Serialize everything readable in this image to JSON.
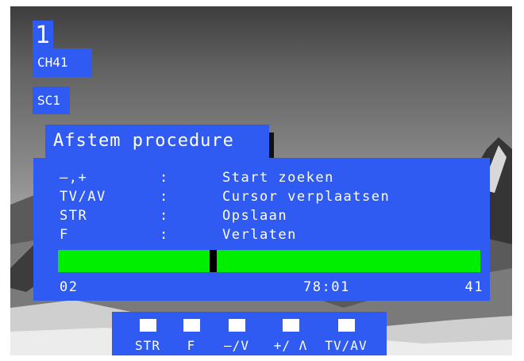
{
  "osd": {
    "program_number": "1",
    "channel": "CH41",
    "source": "SC1"
  },
  "dialog": {
    "title": "Afstem procedure",
    "commands": [
      {
        "key": "–,+",
        "separator": ":",
        "action": "Start zoeken"
      },
      {
        "key": "TV/AV",
        "separator": ":",
        "action": "Cursor verplaatsen"
      },
      {
        "key": "STR",
        "separator": ":",
        "action": "Opslaan"
      },
      {
        "key": "F",
        "separator": ":",
        "action": "Verlaten"
      }
    ],
    "tuning_bar": {
      "position_fraction": 0.365,
      "scale_start": "02",
      "frequency": "78:01",
      "scale_end": "41"
    }
  },
  "hint_bar": {
    "buttons": [
      {
        "label": "STR"
      },
      {
        "label": "F"
      },
      {
        "label": "–/V"
      },
      {
        "label": "+/ Λ"
      },
      {
        "label": "TV/AV"
      }
    ]
  },
  "colors": {
    "osd_blue": "#2f5bf2",
    "bar_green": "#00ef00",
    "marker_black": "#000000",
    "text_white": "#ffffff"
  }
}
